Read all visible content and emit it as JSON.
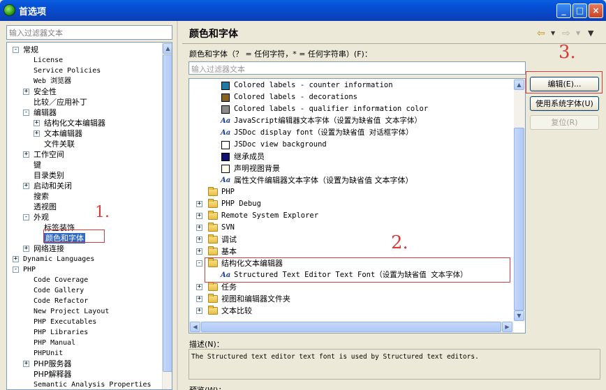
{
  "window": {
    "title": "首选项"
  },
  "left": {
    "filter_placeholder": "输入过滤器文本",
    "tree": [
      {
        "label": "常规",
        "level": 0,
        "expander": "−",
        "mono": false
      },
      {
        "label": "License",
        "level": 1,
        "expander": "",
        "mono": true
      },
      {
        "label": "Service Policies",
        "level": 1,
        "expander": "",
        "mono": true
      },
      {
        "label": "Web 浏览器",
        "level": 1,
        "expander": "",
        "mono": true
      },
      {
        "label": "安全性",
        "level": 1,
        "expander": "+",
        "mono": false
      },
      {
        "label": "比较／应用补丁",
        "level": 1,
        "expander": "",
        "mono": false
      },
      {
        "label": "编辑器",
        "level": 1,
        "expander": "−",
        "mono": false
      },
      {
        "label": "结构化文本编辑器",
        "level": 2,
        "expander": "+",
        "mono": false
      },
      {
        "label": "文本编辑器",
        "level": 2,
        "expander": "+",
        "mono": false
      },
      {
        "label": "文件关联",
        "level": 2,
        "expander": "",
        "mono": false
      },
      {
        "label": "工作空间",
        "level": 1,
        "expander": "+",
        "mono": false
      },
      {
        "label": "键",
        "level": 1,
        "expander": "",
        "mono": false
      },
      {
        "label": "目录类别",
        "level": 1,
        "expander": "",
        "mono": false
      },
      {
        "label": "启动和关闭",
        "level": 1,
        "expander": "+",
        "mono": false
      },
      {
        "label": "搜索",
        "level": 1,
        "expander": "",
        "mono": false
      },
      {
        "label": "透视图",
        "level": 1,
        "expander": "",
        "mono": false
      },
      {
        "label": "外观",
        "level": 1,
        "expander": "−",
        "mono": false
      },
      {
        "label": "标签装饰",
        "level": 2,
        "expander": "",
        "mono": false
      },
      {
        "label": "颜色和字体",
        "level": 2,
        "expander": "",
        "mono": false,
        "selected": true
      },
      {
        "label": "网络连接",
        "level": 1,
        "expander": "+",
        "mono": false
      },
      {
        "label": "Dynamic Languages",
        "level": 0,
        "expander": "+",
        "mono": true
      },
      {
        "label": "PHP",
        "level": 0,
        "expander": "−",
        "mono": true
      },
      {
        "label": "Code Coverage",
        "level": 1,
        "expander": "",
        "mono": true
      },
      {
        "label": "Code Gallery",
        "level": 1,
        "expander": "",
        "mono": true
      },
      {
        "label": "Code Refactor",
        "level": 1,
        "expander": "",
        "mono": true
      },
      {
        "label": "New Project Layout",
        "level": 1,
        "expander": "",
        "mono": true
      },
      {
        "label": "PHP Executables",
        "level": 1,
        "expander": "",
        "mono": true
      },
      {
        "label": "PHP Libraries",
        "level": 1,
        "expander": "",
        "mono": true
      },
      {
        "label": "PHP Manual",
        "level": 1,
        "expander": "",
        "mono": true
      },
      {
        "label": "PHPUnit",
        "level": 1,
        "expander": "",
        "mono": true
      },
      {
        "label": "PHP服务器",
        "level": 1,
        "expander": "+",
        "mono": false
      },
      {
        "label": "PHP解释器",
        "level": 1,
        "expander": "",
        "mono": false
      },
      {
        "label": "Semantic Analysis Properties",
        "level": 1,
        "expander": "",
        "mono": true
      }
    ]
  },
  "right": {
    "title": "颜色和字体",
    "filter_label": "颜色和字体（？ = 任何字符，* = 任何字符串）(F)：",
    "filter_placeholder": "输入过滤器文本",
    "font_rows": [
      {
        "label": "Colored labels - counter information",
        "kind": "swatch",
        "color": "#1f7aa8",
        "indent": 2
      },
      {
        "label": "Colored labels - decorations",
        "kind": "swatch",
        "color": "#8a6220",
        "indent": 2
      },
      {
        "label": "Colored labels - qualifier information color",
        "kind": "swatch",
        "color": "#8c8c8c",
        "indent": 2
      },
      {
        "label": "JavaScript编辑器文本字体（设置为缺省值 文本字体）",
        "kind": "font",
        "indent": 2
      },
      {
        "label": "JSDoc display font（设置为缺省值 对话框字体）",
        "kind": "font",
        "indent": 2
      },
      {
        "label": "JSDoc view background",
        "kind": "swatch",
        "color": "#ffffff",
        "indent": 2
      },
      {
        "label": "继承成员",
        "kind": "swatch",
        "color": "#101070",
        "indent": 2
      },
      {
        "label": "声明视图背景",
        "kind": "swatch",
        "color": "#fffbef",
        "indent": 2
      },
      {
        "label": "属性文件编辑器文本字体（设置为缺省值 文本字体）",
        "kind": "font",
        "indent": 2
      },
      {
        "label": "PHP",
        "kind": "folder",
        "expander": "",
        "indent": 1
      },
      {
        "label": "PHP Debug",
        "kind": "folder",
        "expander": "+",
        "indent": 1
      },
      {
        "label": "Remote System Explorer",
        "kind": "folder",
        "expander": "+",
        "indent": 1
      },
      {
        "label": "SVN",
        "kind": "folder",
        "expander": "+",
        "indent": 1
      },
      {
        "label": "调试",
        "kind": "folder",
        "expander": "+",
        "indent": 1
      },
      {
        "label": "基本",
        "kind": "folder",
        "expander": "+",
        "indent": 1
      },
      {
        "label": "结构化文本编辑器",
        "kind": "folder",
        "expander": "−",
        "indent": 1
      },
      {
        "label": "Structured Text Editor Text Font（设置为缺省值 文本字体）",
        "kind": "font",
        "indent": 2
      },
      {
        "label": "任务",
        "kind": "folder",
        "expander": "+",
        "indent": 1
      },
      {
        "label": "视图和编辑器文件夹",
        "kind": "folder",
        "expander": "+",
        "indent": 1
      },
      {
        "label": "文本比较",
        "kind": "folder",
        "expander": "+",
        "indent": 1
      }
    ],
    "aa_glyph": "Aa",
    "buttons": {
      "edit": "编辑(E)...",
      "use_system_font": "使用系统字体(U)",
      "reset": "复位(R)"
    },
    "description_label": "描述(N)：",
    "description_text": "The Structured text editor text font is used by Structured text editors.",
    "preview_label": "预览(W)："
  },
  "annotations": {
    "mark_1": "1.",
    "mark_2": "2.",
    "mark_3": "3."
  },
  "colors": {
    "titlebar": "#0a50d0",
    "selection": "#316ac5",
    "annotation": "#d93a3a"
  }
}
